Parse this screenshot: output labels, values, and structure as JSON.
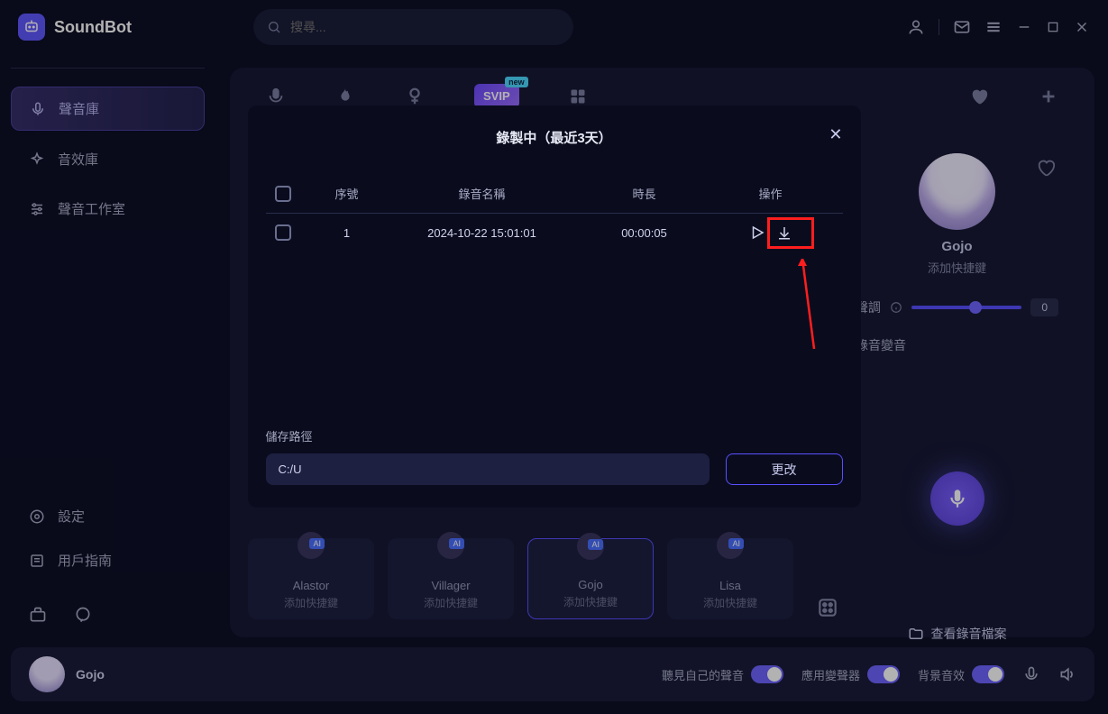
{
  "app": {
    "name": "SoundBot"
  },
  "search": {
    "placeholder": "搜尋..."
  },
  "sidebar": {
    "items": [
      {
        "label": "聲音庫"
      },
      {
        "label": "音效庫"
      },
      {
        "label": "聲音工作室"
      }
    ],
    "settings": "設定",
    "guide": "用戶指南"
  },
  "tabs": {
    "svip": "SVIP",
    "new": "new"
  },
  "right_panel": {
    "name": "Gojo",
    "shortcut": "添加快捷鍵",
    "tone_label": "聲調",
    "tone_value": "0",
    "record_label": "錄音變音",
    "view_files": "查看錄音檔案"
  },
  "voices": [
    {
      "name": "Alastor",
      "sub": "添加快捷鍵"
    },
    {
      "name": "Villager",
      "sub": "添加快捷鍵"
    },
    {
      "name": "Gojo",
      "sub": "添加快捷鍵"
    },
    {
      "name": "Lisa",
      "sub": "添加快捷鍵"
    }
  ],
  "bottom_bar": {
    "name": "Gojo",
    "toggle1": "聽見自己的聲音",
    "toggle2": "應用變聲器",
    "toggle3": "背景音效"
  },
  "modal": {
    "title": "錄製中（最近3天）",
    "headers": {
      "idx": "序號",
      "name": "錄音名稱",
      "dur": "時長",
      "act": "操作"
    },
    "rows": [
      {
        "idx": "1",
        "name": "2024-10-22 15:01:01",
        "dur": "00:00:05"
      }
    ],
    "path_label": "儲存路徑",
    "path_value": "C:/U",
    "change_btn": "更改"
  }
}
